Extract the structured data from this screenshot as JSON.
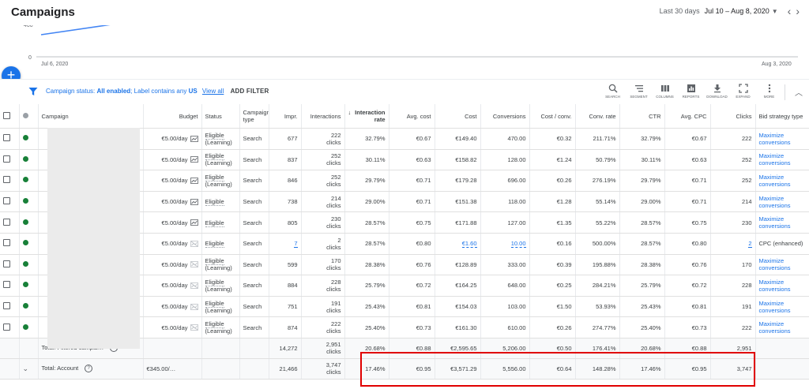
{
  "header": {
    "title": "Campaigns",
    "range_label": "Last 30 days",
    "range_dates": "Jul 10 – Aug 8, 2020"
  },
  "chart": {
    "y_tick_top": "400",
    "y_tick_zero": "0",
    "x_start": "Jul 6, 2020",
    "x_end": "Aug 3, 2020",
    "line_color": "#4285f4"
  },
  "filter": {
    "prefix": "Campaign status: ",
    "status": "All enabled",
    "middle": "; Label contains any ",
    "label": "US",
    "view_all": "View all",
    "add_filter": "ADD FILTER"
  },
  "tools": [
    {
      "icon": "search-icon",
      "label": "SEARCH"
    },
    {
      "icon": "segment-icon",
      "label": "SEGMENT"
    },
    {
      "icon": "columns-icon",
      "label": "COLUMNS"
    },
    {
      "icon": "reports-icon",
      "label": "REPORTS"
    },
    {
      "icon": "download-icon",
      "label": "DOWNLOAD"
    },
    {
      "icon": "expand-icon",
      "label": "EXPAND"
    },
    {
      "icon": "more-icon",
      "label": "MORE"
    }
  ],
  "table": {
    "headers": {
      "campaign": "Campaign",
      "budget": "Budget",
      "status": "Status",
      "type": "Campaign type",
      "impr": "Impr.",
      "interactions": "Interactions",
      "interaction_rate": "Interaction rate",
      "avg_cost": "Avg. cost",
      "cost": "Cost",
      "conversions": "Conversions",
      "cost_conv": "Cost / conv.",
      "conv_rate": "Conv. rate",
      "ctr": "CTR",
      "avg_cpc": "Avg. CPC",
      "clicks": "Clicks",
      "bid": "Bid strategy type"
    },
    "rows": [
      {
        "budget": "€5.00/day",
        "status": "Eligible",
        "status2": "(Learning)",
        "type": "Search",
        "impr": "677",
        "int": "222",
        "int_unit": "clicks",
        "rate": "32.79%",
        "avg_cost": "€0.67",
        "cost": "€149.40",
        "conv": "470.00",
        "cost_conv": "€0.32",
        "conv_rate": "211.71%",
        "ctr": "32.79%",
        "cpc": "€0.67",
        "clicks": "222",
        "bid": "Maximize",
        "bid2": "conversions"
      },
      {
        "budget": "€5.00/day",
        "status": "Eligible",
        "status2": "(Learning)",
        "type": "Search",
        "impr": "837",
        "int": "252",
        "int_unit": "clicks",
        "rate": "30.11%",
        "avg_cost": "€0.63",
        "cost": "€158.82",
        "conv": "128.00",
        "cost_conv": "€1.24",
        "conv_rate": "50.79%",
        "ctr": "30.11%",
        "cpc": "€0.63",
        "clicks": "252",
        "bid": "Maximize",
        "bid2": "conversions"
      },
      {
        "budget": "€5.00/day",
        "status": "Eligible",
        "status2": "(Learning)",
        "type": "Search",
        "impr": "846",
        "int": "252",
        "int_unit": "clicks",
        "rate": "29.79%",
        "avg_cost": "€0.71",
        "cost": "€179.28",
        "conv": "696.00",
        "cost_conv": "€0.26",
        "conv_rate": "276.19%",
        "ctr": "29.79%",
        "cpc": "€0.71",
        "clicks": "252",
        "bid": "Maximize",
        "bid2": "conversions"
      },
      {
        "budget": "€5.00/day",
        "status": "Eligible",
        "status2": "",
        "type": "Search",
        "impr": "738",
        "int": "214",
        "int_unit": "clicks",
        "rate": "29.00%",
        "avg_cost": "€0.71",
        "cost": "€151.38",
        "conv": "118.00",
        "cost_conv": "€1.28",
        "conv_rate": "55.14%",
        "ctr": "29.00%",
        "cpc": "€0.71",
        "clicks": "214",
        "bid": "Maximize",
        "bid2": "conversions"
      },
      {
        "budget": "€5.00/day",
        "status": "Eligible",
        "status2": "",
        "type": "Search",
        "impr": "805",
        "int": "230",
        "int_unit": "clicks",
        "rate": "28.57%",
        "avg_cost": "€0.75",
        "cost": "€171.88",
        "conv": "127.00",
        "cost_conv": "€1.35",
        "conv_rate": "55.22%",
        "ctr": "28.57%",
        "cpc": "€0.75",
        "clicks": "230",
        "bid": "Maximize",
        "bid2": "conversions"
      },
      {
        "budget": "€5.00/day",
        "status": "Eligible",
        "status2": "",
        "type": "Search",
        "impr": "7",
        "int": "2",
        "int_unit": "clicks",
        "rate": "28.57%",
        "avg_cost": "€0.80",
        "cost": "€1.60",
        "conv": "10.00",
        "cost_conv": "€0.16",
        "conv_rate": "500.00%",
        "ctr": "28.57%",
        "cpc": "€0.80",
        "clicks": "2",
        "bid": "CPC (enhanced)",
        "bid2": ""
      },
      {
        "budget": "€5.00/day",
        "status": "Eligible",
        "status2": "(Learning)",
        "type": "Search",
        "impr": "599",
        "int": "170",
        "int_unit": "clicks",
        "rate": "28.38%",
        "avg_cost": "€0.76",
        "cost": "€128.89",
        "conv": "333.00",
        "cost_conv": "€0.39",
        "conv_rate": "195.88%",
        "ctr": "28.38%",
        "cpc": "€0.76",
        "clicks": "170",
        "bid": "Maximize",
        "bid2": "conversions"
      },
      {
        "budget": "€5.00/day",
        "status": "Eligible",
        "status2": "(Learning)",
        "type": "Search",
        "impr": "884",
        "int": "228",
        "int_unit": "clicks",
        "rate": "25.79%",
        "avg_cost": "€0.72",
        "cost": "€164.25",
        "conv": "648.00",
        "cost_conv": "€0.25",
        "conv_rate": "284.21%",
        "ctr": "25.79%",
        "cpc": "€0.72",
        "clicks": "228",
        "bid": "Maximize",
        "bid2": "conversions"
      },
      {
        "budget": "€5.00/day",
        "status": "Eligible",
        "status2": "(Learning)",
        "type": "Search",
        "impr": "751",
        "int": "191",
        "int_unit": "clicks",
        "rate": "25.43%",
        "avg_cost": "€0.81",
        "cost": "€154.03",
        "conv": "103.00",
        "cost_conv": "€1.50",
        "conv_rate": "53.93%",
        "ctr": "25.43%",
        "cpc": "€0.81",
        "clicks": "191",
        "bid": "Maximize",
        "bid2": "conversions"
      },
      {
        "budget": "€5.00/day",
        "status": "Eligible",
        "status2": "(Learning)",
        "type": "Search",
        "impr": "874",
        "int": "222",
        "int_unit": "clicks",
        "rate": "25.40%",
        "avg_cost": "€0.73",
        "cost": "€161.30",
        "conv": "610.00",
        "cost_conv": "€0.26",
        "conv_rate": "274.77%",
        "ctr": "25.40%",
        "cpc": "€0.73",
        "clicks": "222",
        "bid": "Maximize",
        "bid2": "conversions"
      }
    ],
    "totals": [
      {
        "label": "Total: Filtered campai…",
        "budget": "",
        "impr": "14,272",
        "int": "2,951",
        "int_unit": "clicks",
        "rate": "20.68%",
        "avg_cost": "€0.88",
        "cost": "€2,595.65",
        "conv": "5,206.00",
        "cost_conv": "€0.50",
        "conv_rate": "176.41%",
        "ctr": "20.68%",
        "cpc": "€0.88",
        "clicks": "2,951"
      },
      {
        "label": "Total: Account",
        "budget": "€345.00/…",
        "impr": "21,466",
        "int": "3,747",
        "int_unit": "clicks",
        "rate": "17.46%",
        "avg_cost": "€0.95",
        "cost": "€3,571.29",
        "conv": "5,556.00",
        "cost_conv": "€0.64",
        "conv_rate": "148.28%",
        "ctr": "17.46%",
        "cpc": "€0.95",
        "clicks": "3,747"
      }
    ]
  }
}
